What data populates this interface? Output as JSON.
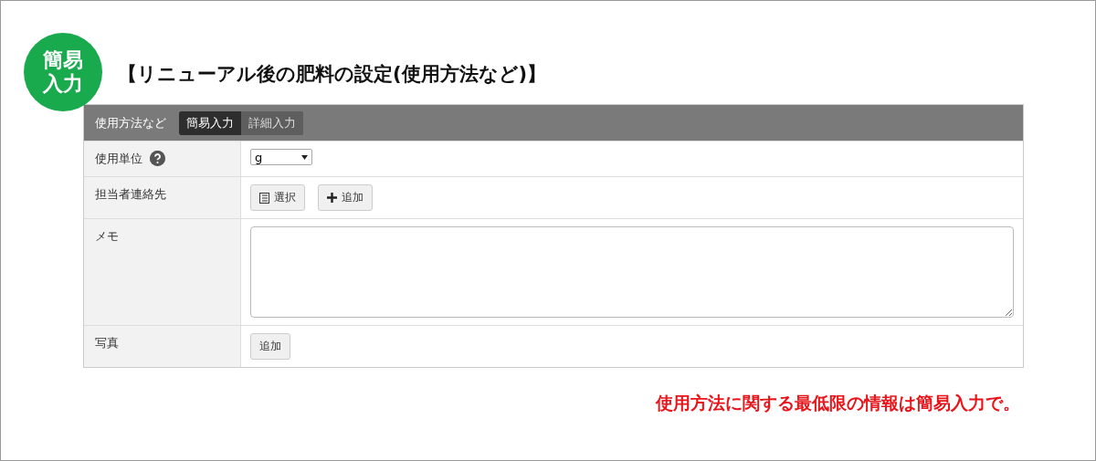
{
  "badge": {
    "lines": [
      "簡易",
      "入力"
    ]
  },
  "title": "【リニューアル後の肥料の設定(使用方法など)】",
  "panel": {
    "header": "使用方法など",
    "tabs": [
      {
        "label": "簡易入力",
        "selected": true
      },
      {
        "label": "詳細入力",
        "selected": false
      }
    ],
    "rows": [
      {
        "label": "使用単位",
        "help": true,
        "kind": "select",
        "value": "g"
      },
      {
        "label": "担当者連絡先",
        "help": false,
        "kind": "buttons",
        "buttons": [
          {
            "label": "選択",
            "kind": "list"
          },
          {
            "label": "追加",
            "kind": "plus"
          }
        ]
      },
      {
        "label": "メモ",
        "help": false,
        "kind": "textarea"
      },
      {
        "label": "写真",
        "help": false,
        "kind": "buttons",
        "buttons": [
          {
            "label": "追加",
            "kind": "plain"
          }
        ]
      }
    ]
  },
  "note": "使用方法に関する最低限の情報は簡易入力で。"
}
